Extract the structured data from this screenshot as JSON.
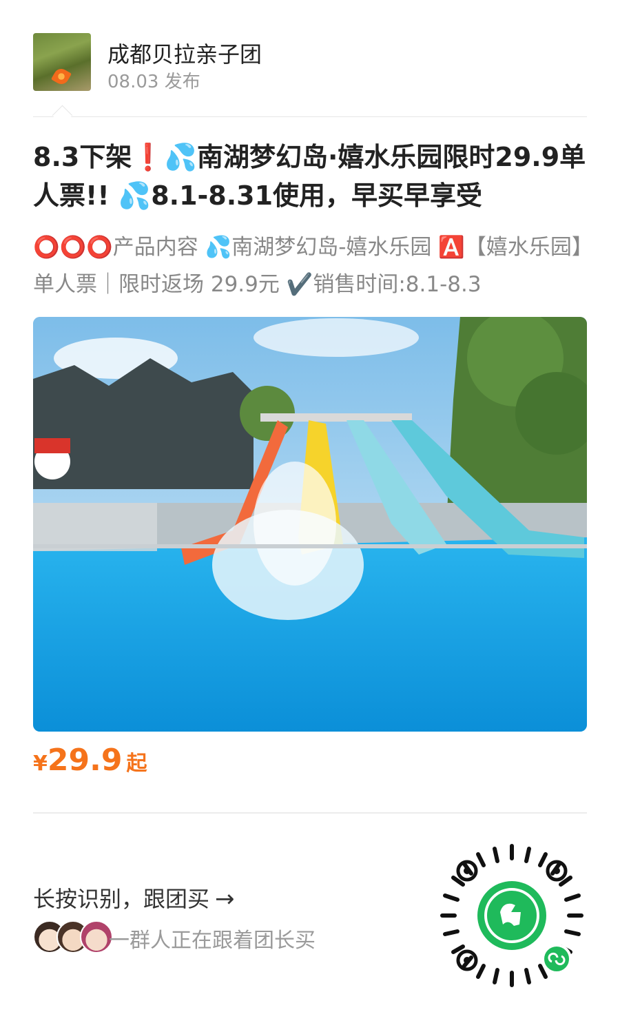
{
  "author": {
    "name": "成都贝拉亲子团",
    "date": "08.03 发布"
  },
  "post": {
    "title": "8.3下架❗️💦南湖梦幻岛·嬉水乐园限时29.9单人票!! 💦8.1-8.31使用，早买早享受",
    "description": "⭕⭕⭕产品内容 💦南湖梦幻岛-嬉水乐园 🅰️【嬉水乐园】单人票｜限时返场 29.9元 ✔️销售时间:8.1-8.3"
  },
  "price": {
    "symbol": "¥",
    "value": "29.9",
    "suffix": "起"
  },
  "cta": {
    "label": "长按识别，跟团买",
    "arrow": "→"
  },
  "followers": {
    "text": "一群人正在跟着团长买"
  },
  "icons": {
    "author_avatar": "author-avatar-photo",
    "hero": "water-slide-photo",
    "qr": "mini-program-qr-icon"
  },
  "colors": {
    "price": "#f5731b",
    "qr_green": "#1fba5b"
  }
}
